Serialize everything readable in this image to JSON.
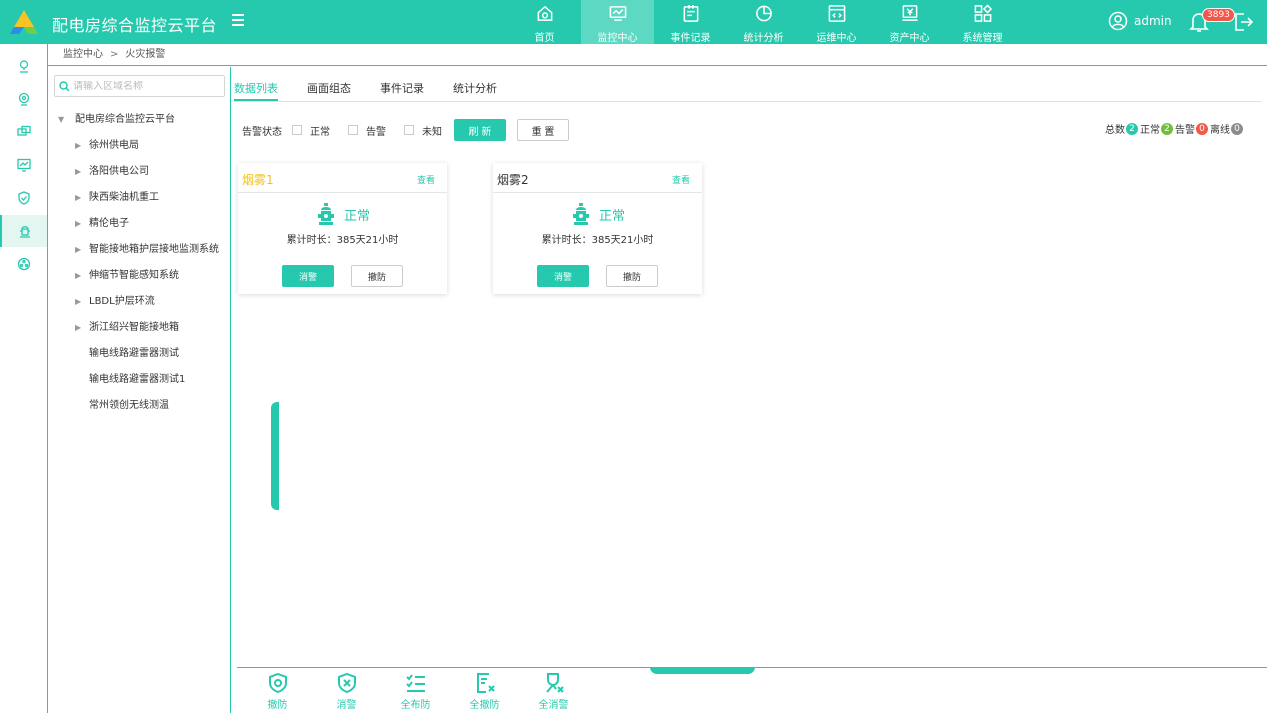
{
  "header": {
    "app_title": "配电房综合监控云平台",
    "nav": [
      {
        "label": "首页",
        "icon": "home-icon"
      },
      {
        "label": "监控中心",
        "icon": "monitor-icon",
        "active": true
      },
      {
        "label": "事件记录",
        "icon": "event-record-icon"
      },
      {
        "label": "统计分析",
        "icon": "pie-chart-icon"
      },
      {
        "label": "运维中心",
        "icon": "code-window-icon"
      },
      {
        "label": "资产中心",
        "icon": "yen-asset-icon"
      },
      {
        "label": "系统管理",
        "icon": "grid-settings-icon"
      }
    ],
    "username": "admin",
    "notification_count": "3893"
  },
  "breadcrumb": {
    "parent": "监控中心",
    "separator": ">",
    "current": "火灾报警"
  },
  "tree": {
    "search_placeholder": "请输入区域名称",
    "root": "配电房综合监控云平台",
    "nodes": [
      "徐州供电局",
      "洛阳供电公司",
      "陕西柴油机重工",
      "精伦电子",
      "智能接地箱护层接地监测系统",
      "伸缩节智能感知系统",
      "LBDL护层环流",
      "浙江绍兴智能接地箱",
      "输电线路避雷器测试",
      "输电线路避雷器测试1",
      "常州领创无线测温"
    ]
  },
  "tabs": [
    "数据列表",
    "画面组态",
    "事件记录",
    "统计分析"
  ],
  "filters": {
    "label": "告警状态",
    "options": [
      "正常",
      "告警",
      "未知"
    ],
    "refresh_label": "刷 新",
    "reset_label": "重 置"
  },
  "stats": {
    "total_label": "总数",
    "total": "2",
    "normal_label": "正常",
    "normal": "2",
    "alarm_label": "告警",
    "alarm": "0",
    "offline_label": "离线",
    "offline": "0",
    "colors": {
      "total": "#26c9ad",
      "normal": "#6fbf3a",
      "alarm": "#f5564a",
      "offline": "#8c8c8c"
    }
  },
  "devices": [
    {
      "name": "烟雾1",
      "view": "查看",
      "status": "正常",
      "duration": "累计时长：385天21小时",
      "btn_clear": "消警",
      "btn_disarm": "撤防",
      "name_color": "#f2c11d"
    },
    {
      "name": "烟雾2",
      "view": "查看",
      "status": "正常",
      "duration": "累计时长：385天21小时",
      "btn_clear": "消警",
      "btn_disarm": "撤防",
      "name_color": "#333333"
    }
  ],
  "bottom_tools": [
    {
      "label": "撤防",
      "icon": "disarm-shield-icon"
    },
    {
      "label": "消警",
      "icon": "clear-alarm-shield-icon"
    },
    {
      "label": "全布防",
      "icon": "arm-all-list-icon"
    },
    {
      "label": "全撤防",
      "icon": "disarm-all-doc-icon"
    },
    {
      "label": "全消警",
      "icon": "clear-all-alarm-icon"
    }
  ],
  "accent_color": "#26c9ad"
}
